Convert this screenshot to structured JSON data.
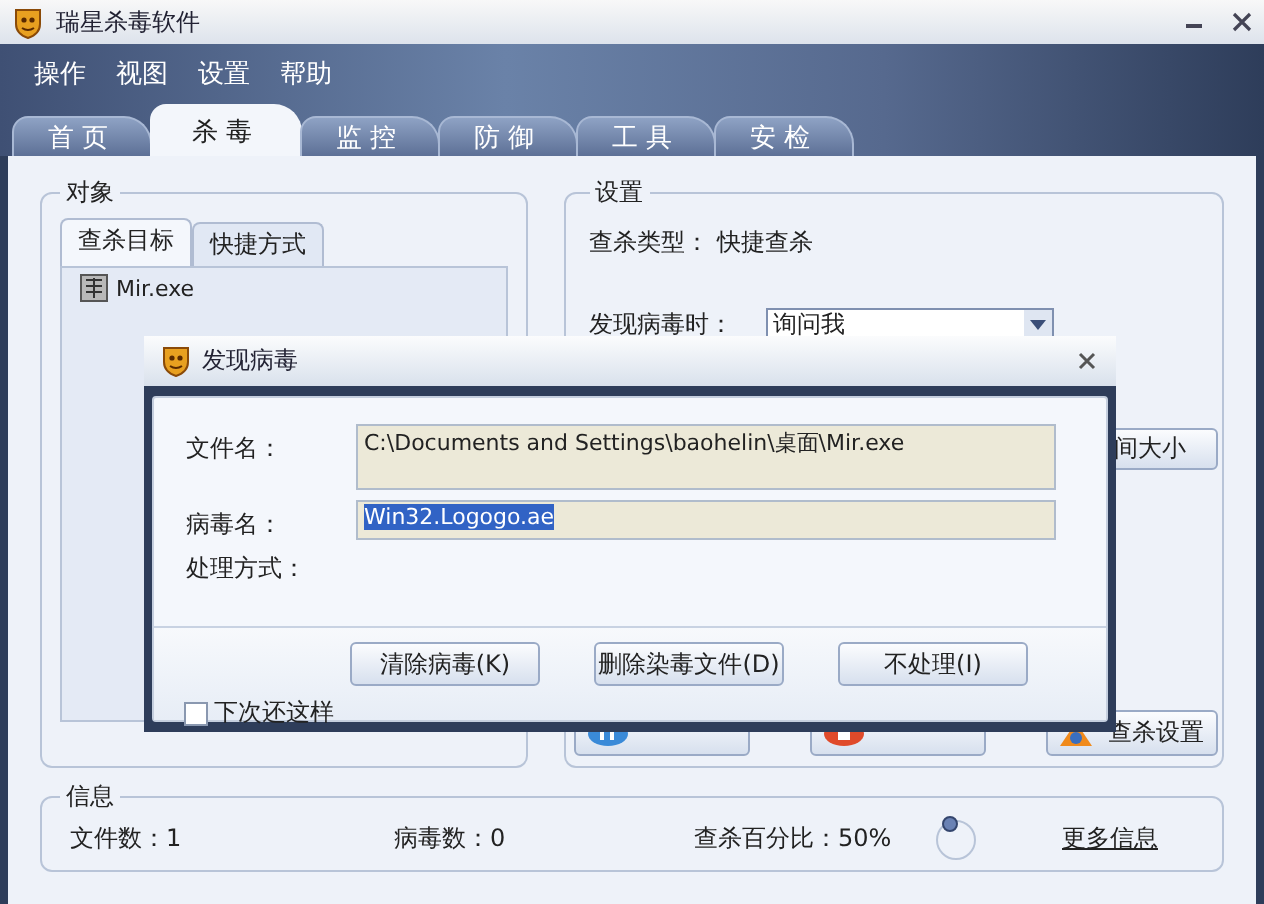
{
  "window": {
    "title": "瑞星杀毒软件"
  },
  "menu": [
    "操作",
    "视图",
    "设置",
    "帮助"
  ],
  "tabs": [
    {
      "label": "首页",
      "selected": false
    },
    {
      "label": "杀毒",
      "selected": true
    },
    {
      "label": "监控",
      "selected": false
    },
    {
      "label": "防御",
      "selected": false
    },
    {
      "label": "工具",
      "selected": false
    },
    {
      "label": "安检",
      "selected": false
    }
  ],
  "object_panel": {
    "title": "对象",
    "subtabs": [
      {
        "label": "查杀目标",
        "selected": true
      },
      {
        "label": "快捷方式",
        "selected": false
      }
    ],
    "items": [
      {
        "name": "Mir.exe"
      }
    ]
  },
  "settings_panel": {
    "title": "设置",
    "scan_type_label": "查杀类型：",
    "scan_type": "快捷查杀",
    "on_virus_label": "发现病毒时：",
    "on_virus_value": "询问我",
    "side_button": "间大小"
  },
  "action_buttons": [
    {
      "kind": "pause"
    },
    {
      "kind": "stop"
    },
    {
      "kind": "settings",
      "label": "查杀设置"
    }
  ],
  "info": {
    "title": "信息",
    "files": "文件数：1",
    "viruses": "病毒数：0",
    "percent": "查杀百分比：50%",
    "more": "更多信息"
  },
  "dialog": {
    "title": "发现病毒",
    "fields": [
      {
        "label": "文件名：",
        "value": "C:\\Documents and Settings\\baohelin\\桌面\\Mir.exe",
        "selected": false,
        "kind": "tall"
      },
      {
        "label": "病毒名：",
        "value": "Win32.Logogo.ae",
        "selected": true,
        "kind": "short"
      }
    ],
    "action_label": "处理方式：",
    "buttons": [
      "清除病毒(K)",
      "删除染毒文件(D)",
      "不处理(I)"
    ],
    "remember": {
      "label": "下次还这样",
      "checked": false
    }
  }
}
